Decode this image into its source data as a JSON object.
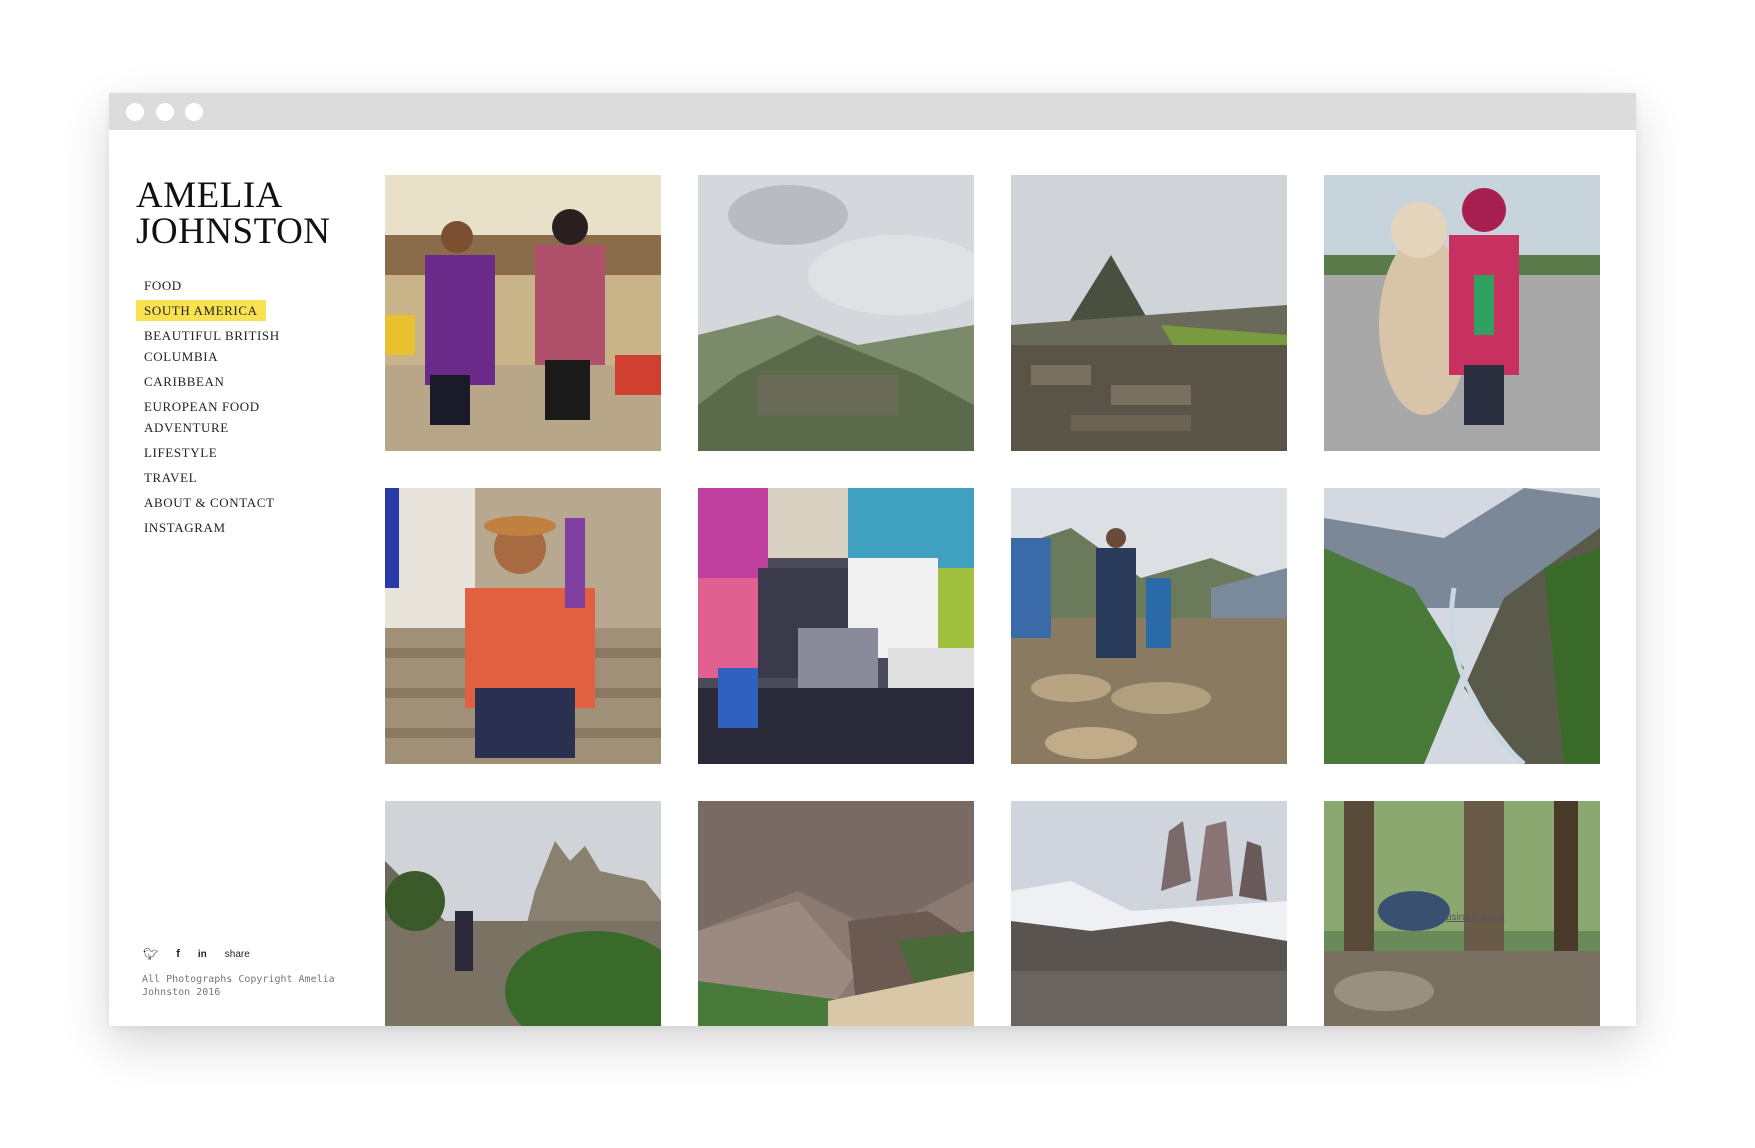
{
  "site": {
    "name_line1": "AMELIA",
    "name_line2": "JOHNSTON"
  },
  "nav": {
    "items": [
      {
        "label": "FOOD",
        "active": false
      },
      {
        "label": "SOUTH AMERICA",
        "active": true
      },
      {
        "label": "BEAUTIFUL BRITISH COLUMBIA",
        "active": false
      },
      {
        "label": "CARIBBEAN",
        "active": false
      },
      {
        "label": "EUROPEAN FOOD ADVENTURE",
        "active": false
      },
      {
        "label": "LIFESTYLE",
        "active": false
      },
      {
        "label": "TRAVEL",
        "active": false
      },
      {
        "label": "ABOUT & CONTACT",
        "active": false
      },
      {
        "label": "INSTAGRAM",
        "active": false
      }
    ],
    "active_highlight_color": "#f8e252"
  },
  "social": {
    "twitter_icon": "twitter-icon",
    "facebook_icon": "facebook-icon",
    "linkedin_icon": "linkedin-icon",
    "share_label": "share"
  },
  "footer": {
    "copyright": "All Photographs Copyright Amelia Johnston 2016"
  },
  "credit": {
    "label": "using Format"
  },
  "gallery": {
    "photos": [
      {
        "subject": "market-women"
      },
      {
        "subject": "misty-machu-picchu"
      },
      {
        "subject": "machu-picchu-ruins"
      },
      {
        "subject": "child-with-alpaca"
      },
      {
        "subject": "musician-on-steps"
      },
      {
        "subject": "textile-market"
      },
      {
        "subject": "hikers-on-trail"
      },
      {
        "subject": "mountain-valley"
      },
      {
        "subject": "hiker-rocky-peaks"
      },
      {
        "subject": "mountain-slope"
      },
      {
        "subject": "torres-del-paine"
      },
      {
        "subject": "forest-campsite"
      }
    ]
  }
}
